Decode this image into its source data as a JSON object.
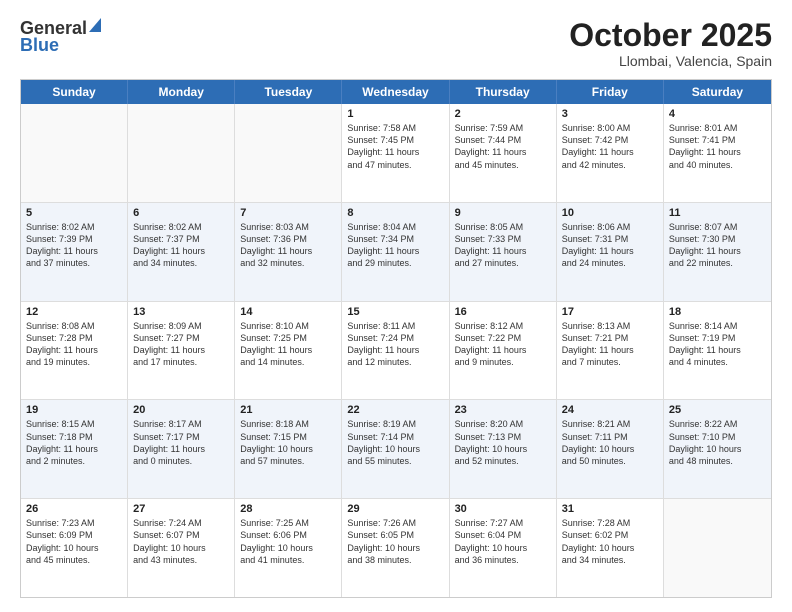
{
  "header": {
    "logo_general": "General",
    "logo_blue": "Blue",
    "month_title": "October 2025",
    "location": "Llombai, Valencia, Spain"
  },
  "weekdays": [
    "Sunday",
    "Monday",
    "Tuesday",
    "Wednesday",
    "Thursday",
    "Friday",
    "Saturday"
  ],
  "rows": [
    [
      {
        "day": "",
        "lines": [],
        "empty": true
      },
      {
        "day": "",
        "lines": [],
        "empty": true
      },
      {
        "day": "",
        "lines": [],
        "empty": true
      },
      {
        "day": "1",
        "lines": [
          "Sunrise: 7:58 AM",
          "Sunset: 7:45 PM",
          "Daylight: 11 hours",
          "and 47 minutes."
        ]
      },
      {
        "day": "2",
        "lines": [
          "Sunrise: 7:59 AM",
          "Sunset: 7:44 PM",
          "Daylight: 11 hours",
          "and 45 minutes."
        ]
      },
      {
        "day": "3",
        "lines": [
          "Sunrise: 8:00 AM",
          "Sunset: 7:42 PM",
          "Daylight: 11 hours",
          "and 42 minutes."
        ]
      },
      {
        "day": "4",
        "lines": [
          "Sunrise: 8:01 AM",
          "Sunset: 7:41 PM",
          "Daylight: 11 hours",
          "and 40 minutes."
        ]
      }
    ],
    [
      {
        "day": "5",
        "lines": [
          "Sunrise: 8:02 AM",
          "Sunset: 7:39 PM",
          "Daylight: 11 hours",
          "and 37 minutes."
        ]
      },
      {
        "day": "6",
        "lines": [
          "Sunrise: 8:02 AM",
          "Sunset: 7:37 PM",
          "Daylight: 11 hours",
          "and 34 minutes."
        ]
      },
      {
        "day": "7",
        "lines": [
          "Sunrise: 8:03 AM",
          "Sunset: 7:36 PM",
          "Daylight: 11 hours",
          "and 32 minutes."
        ]
      },
      {
        "day": "8",
        "lines": [
          "Sunrise: 8:04 AM",
          "Sunset: 7:34 PM",
          "Daylight: 11 hours",
          "and 29 minutes."
        ]
      },
      {
        "day": "9",
        "lines": [
          "Sunrise: 8:05 AM",
          "Sunset: 7:33 PM",
          "Daylight: 11 hours",
          "and 27 minutes."
        ]
      },
      {
        "day": "10",
        "lines": [
          "Sunrise: 8:06 AM",
          "Sunset: 7:31 PM",
          "Daylight: 11 hours",
          "and 24 minutes."
        ]
      },
      {
        "day": "11",
        "lines": [
          "Sunrise: 8:07 AM",
          "Sunset: 7:30 PM",
          "Daylight: 11 hours",
          "and 22 minutes."
        ]
      }
    ],
    [
      {
        "day": "12",
        "lines": [
          "Sunrise: 8:08 AM",
          "Sunset: 7:28 PM",
          "Daylight: 11 hours",
          "and 19 minutes."
        ]
      },
      {
        "day": "13",
        "lines": [
          "Sunrise: 8:09 AM",
          "Sunset: 7:27 PM",
          "Daylight: 11 hours",
          "and 17 minutes."
        ]
      },
      {
        "day": "14",
        "lines": [
          "Sunrise: 8:10 AM",
          "Sunset: 7:25 PM",
          "Daylight: 11 hours",
          "and 14 minutes."
        ]
      },
      {
        "day": "15",
        "lines": [
          "Sunrise: 8:11 AM",
          "Sunset: 7:24 PM",
          "Daylight: 11 hours",
          "and 12 minutes."
        ]
      },
      {
        "day": "16",
        "lines": [
          "Sunrise: 8:12 AM",
          "Sunset: 7:22 PM",
          "Daylight: 11 hours",
          "and 9 minutes."
        ]
      },
      {
        "day": "17",
        "lines": [
          "Sunrise: 8:13 AM",
          "Sunset: 7:21 PM",
          "Daylight: 11 hours",
          "and 7 minutes."
        ]
      },
      {
        "day": "18",
        "lines": [
          "Sunrise: 8:14 AM",
          "Sunset: 7:19 PM",
          "Daylight: 11 hours",
          "and 4 minutes."
        ]
      }
    ],
    [
      {
        "day": "19",
        "lines": [
          "Sunrise: 8:15 AM",
          "Sunset: 7:18 PM",
          "Daylight: 11 hours",
          "and 2 minutes."
        ]
      },
      {
        "day": "20",
        "lines": [
          "Sunrise: 8:17 AM",
          "Sunset: 7:17 PM",
          "Daylight: 11 hours",
          "and 0 minutes."
        ]
      },
      {
        "day": "21",
        "lines": [
          "Sunrise: 8:18 AM",
          "Sunset: 7:15 PM",
          "Daylight: 10 hours",
          "and 57 minutes."
        ]
      },
      {
        "day": "22",
        "lines": [
          "Sunrise: 8:19 AM",
          "Sunset: 7:14 PM",
          "Daylight: 10 hours",
          "and 55 minutes."
        ]
      },
      {
        "day": "23",
        "lines": [
          "Sunrise: 8:20 AM",
          "Sunset: 7:13 PM",
          "Daylight: 10 hours",
          "and 52 minutes."
        ]
      },
      {
        "day": "24",
        "lines": [
          "Sunrise: 8:21 AM",
          "Sunset: 7:11 PM",
          "Daylight: 10 hours",
          "and 50 minutes."
        ]
      },
      {
        "day": "25",
        "lines": [
          "Sunrise: 8:22 AM",
          "Sunset: 7:10 PM",
          "Daylight: 10 hours",
          "and 48 minutes."
        ]
      }
    ],
    [
      {
        "day": "26",
        "lines": [
          "Sunrise: 7:23 AM",
          "Sunset: 6:09 PM",
          "Daylight: 10 hours",
          "and 45 minutes."
        ]
      },
      {
        "day": "27",
        "lines": [
          "Sunrise: 7:24 AM",
          "Sunset: 6:07 PM",
          "Daylight: 10 hours",
          "and 43 minutes."
        ]
      },
      {
        "day": "28",
        "lines": [
          "Sunrise: 7:25 AM",
          "Sunset: 6:06 PM",
          "Daylight: 10 hours",
          "and 41 minutes."
        ]
      },
      {
        "day": "29",
        "lines": [
          "Sunrise: 7:26 AM",
          "Sunset: 6:05 PM",
          "Daylight: 10 hours",
          "and 38 minutes."
        ]
      },
      {
        "day": "30",
        "lines": [
          "Sunrise: 7:27 AM",
          "Sunset: 6:04 PM",
          "Daylight: 10 hours",
          "and 36 minutes."
        ]
      },
      {
        "day": "31",
        "lines": [
          "Sunrise: 7:28 AM",
          "Sunset: 6:02 PM",
          "Daylight: 10 hours",
          "and 34 minutes."
        ]
      },
      {
        "day": "",
        "lines": [],
        "empty": true
      }
    ]
  ]
}
